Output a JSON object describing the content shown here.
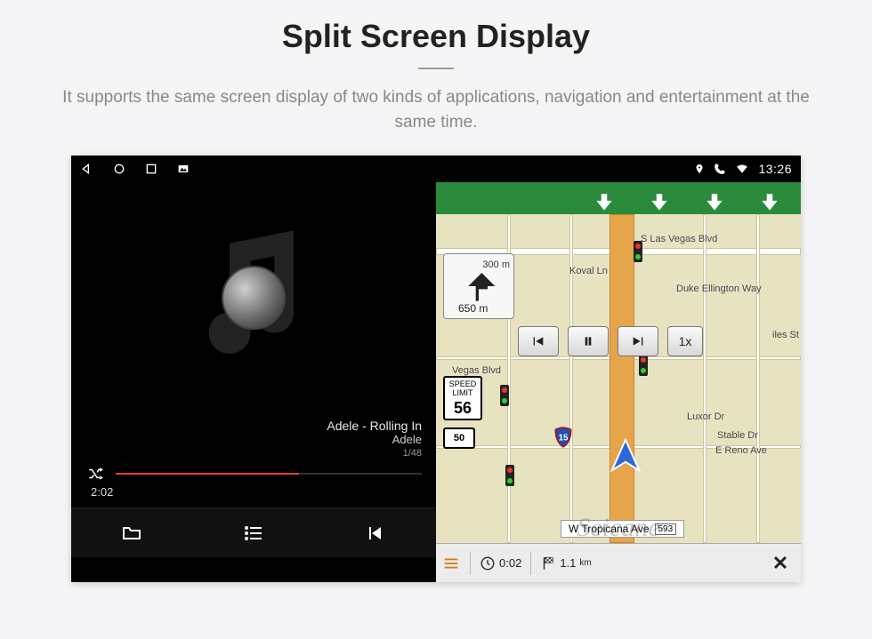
{
  "page": {
    "title": "Split Screen Display",
    "subtitle": "It supports the same screen display of two kinds of applications, navigation and entertainment at the same time."
  },
  "status": {
    "time": "13:26"
  },
  "music": {
    "track_title": "Adele - Rolling In",
    "artist": "Adele",
    "track_count": "1/48",
    "elapsed": "2:02"
  },
  "nav": {
    "turn_dist_next": "300 m",
    "turn_dist_main": "650 m",
    "speed_label": "SPEED LIMIT",
    "speed_value": "56",
    "route_sign": "50",
    "interstate": "15",
    "speed_btn": "1x",
    "streets": {
      "s_las_vegas": "S Las Vegas Blvd",
      "koval": "Koval Ln",
      "duke": "Duke Ellington Way",
      "luxor": "Luxor Dr",
      "reno": "E Reno Ave",
      "vegas_blvd": "Vegas Blvd",
      "tropicana": "W Tropicana Ave",
      "tropicana_tag": "593",
      "miles": "iles St",
      "stable": "Stable Dr"
    },
    "footer": {
      "eta": "0:02",
      "dist": "1.1",
      "dist_unit": "km"
    }
  },
  "watermark": "Seicane"
}
